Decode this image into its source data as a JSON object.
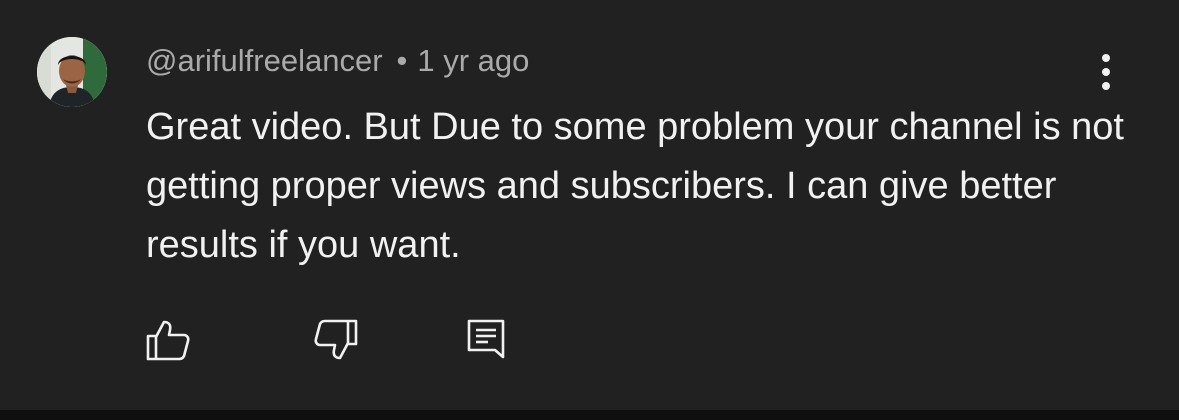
{
  "comment": {
    "author": "@arifulfreelancer",
    "separator": "•",
    "timestamp": "1 yr ago",
    "text": "Great video. But Due to some problem your channel is not getting proper views and subscribers. I can give better results if you want."
  },
  "icons": {
    "avatar": "user-avatar",
    "more": "more-vertical-icon",
    "like": "thumbs-up-icon",
    "dislike": "thumbs-down-icon",
    "reply": "reply-comment-icon"
  },
  "colors": {
    "background": "#212121",
    "primary_text": "#f1f1f1",
    "secondary_text": "#aaaaaa"
  }
}
